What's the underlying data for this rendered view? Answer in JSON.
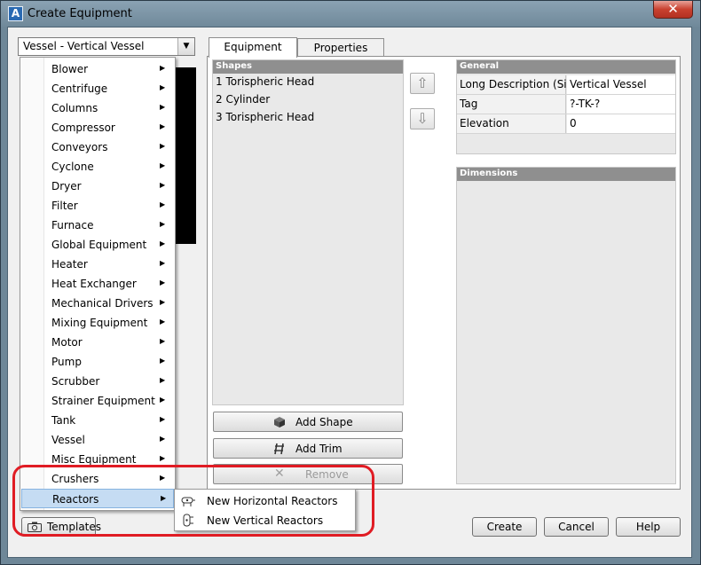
{
  "window": {
    "title": "Create Equipment",
    "app_icon_letter": "A",
    "close_glyph": "✕"
  },
  "equipment_combo": {
    "value": "Vessel - Vertical Vessel",
    "arrow": "▼"
  },
  "category_menu": {
    "submenu_arrow": "▶",
    "items": [
      {
        "label": "Blower"
      },
      {
        "label": "Centrifuge"
      },
      {
        "label": "Columns"
      },
      {
        "label": "Compressor"
      },
      {
        "label": "Conveyors"
      },
      {
        "label": "Cyclone"
      },
      {
        "label": "Dryer"
      },
      {
        "label": "Filter"
      },
      {
        "label": "Furnace"
      },
      {
        "label": "Global Equipment"
      },
      {
        "label": "Heater"
      },
      {
        "label": "Heat Exchanger"
      },
      {
        "label": "Mechanical Drivers"
      },
      {
        "label": "Mixing Equipment"
      },
      {
        "label": "Motor"
      },
      {
        "label": "Pump"
      },
      {
        "label": "Scrubber"
      },
      {
        "label": "Strainer Equipment"
      },
      {
        "label": "Tank"
      },
      {
        "label": "Vessel"
      },
      {
        "label": "Misc Equipment"
      },
      {
        "label": "Crushers"
      },
      {
        "label": "Reactors",
        "selected": true
      }
    ]
  },
  "reactors_submenu": {
    "items": [
      {
        "label": "New Horizontal Reactors",
        "icon": "horizontal-reactor-icon"
      },
      {
        "label": "New Vertical Reactors",
        "icon": "vertical-reactor-icon"
      }
    ]
  },
  "templates_button": {
    "label": "Templates",
    "icon": "camera-icon"
  },
  "tabs": [
    {
      "label": "Equipment",
      "active": true
    },
    {
      "label": "Properties",
      "active": false
    }
  ],
  "shapes": {
    "header": "Shapes",
    "items": [
      "1 Torispheric Head",
      "2 Cylinder",
      "3 Torispheric Head"
    ],
    "move_up": "⇧",
    "move_down": "⇩"
  },
  "general": {
    "header": "General",
    "rows": [
      {
        "name": "Long Description (Size)",
        "value": "Vertical Vessel"
      },
      {
        "name": "Tag",
        "value": "?-TK-?"
      },
      {
        "name": "Elevation",
        "value": "0"
      }
    ]
  },
  "dimensions": {
    "header": "Dimensions"
  },
  "actions": {
    "add_shape": "Add Shape",
    "add_trim": "Add Trim",
    "remove": "Remove",
    "remove_glyph": "✕"
  },
  "dialog_buttons": {
    "create": "Create",
    "cancel": "Cancel",
    "help": "Help"
  },
  "colors": {
    "highlight": "#e01c24",
    "selected_item": "#c5dcf3",
    "section_header": "#8f8f8f"
  }
}
